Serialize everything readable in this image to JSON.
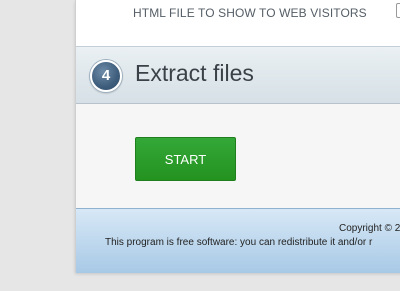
{
  "html_file_section": {
    "label": "HTML FILE TO SHOW TO WEB VISITORS"
  },
  "step": {
    "number": "4",
    "title": "Extract files"
  },
  "start_button": {
    "label": "START"
  },
  "footer": {
    "copyright": "Copyright © 2",
    "license": "This program is free software: you can redistribute it and/or r"
  },
  "colors": {
    "start_button": "#2a9d2a",
    "footer": "#c4dcf0",
    "step_badge": "#3e5d7c"
  }
}
